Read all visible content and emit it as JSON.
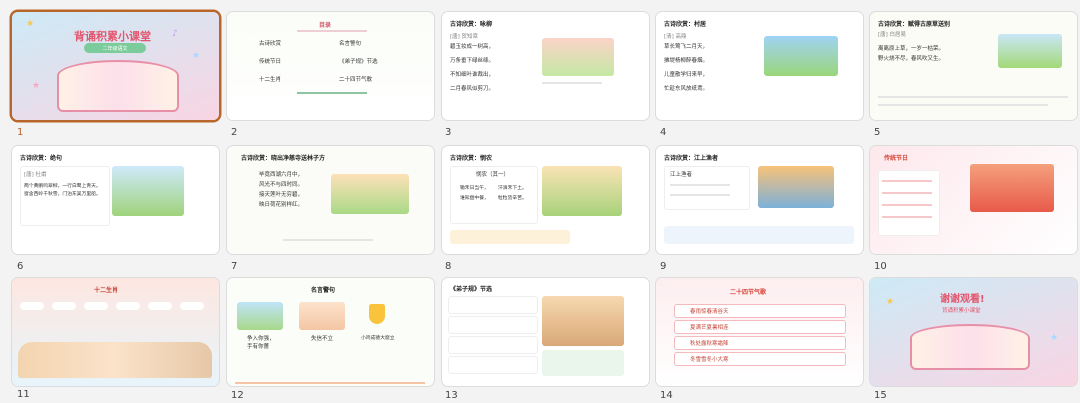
{
  "slides": [
    {
      "num": "1",
      "title": "背诵积累小课堂",
      "subtitle": "二年级语文"
    },
    {
      "num": "2",
      "title": "目录",
      "items": [
        "古诗欣赏",
        "名言警句",
        "传统节日",
        "《弟子规》节选",
        "十二生肖",
        "二十四节气歌"
      ]
    },
    {
      "num": "3",
      "title": "古诗欣赏：咏柳",
      "author": "[唐] 贺知章",
      "lines": [
        "碧玉妆成一树高，",
        "万条垂下绿丝绦。",
        "不知细叶谁裁出，",
        "二月春风似剪刀。"
      ]
    },
    {
      "num": "4",
      "title": "古诗欣赏：村居",
      "author": "[清] 高鼎",
      "lines": [
        "草长莺飞二月天，",
        "拂堤杨柳醉春烟。",
        "儿童散学归来早，",
        "忙趁东风放纸鸢。"
      ]
    },
    {
      "num": "5",
      "title": "古诗欣赏：赋得古原草送别",
      "author": "[唐] 白居易",
      "lines": [
        "离离原上草，一岁一枯荣。",
        "野火烧不尽，春风吹又生。"
      ]
    },
    {
      "num": "6",
      "title": "古诗欣赏：绝句",
      "author": "[唐] 杜甫",
      "lines": [
        "两个黄鹂鸣翠柳，一行白鹭上青天。",
        "窗含西岭千秋雪，门泊东吴万里船。"
      ]
    },
    {
      "num": "7",
      "title": "古诗欣赏：晓出净慈寺送林子方",
      "lines": [
        "毕竟西湖六月中，",
        "风光不与四时同。",
        "接天莲叶无穷碧，",
        "映日荷花别样红。"
      ]
    },
    {
      "num": "8",
      "title": "古诗欣赏：悯农",
      "poem_title": "悯农（其一）",
      "lines": [
        "锄禾日当午，",
        "汗滴禾下土。",
        "谁知盘中餐，",
        "粒粒皆辛苦。"
      ]
    },
    {
      "num": "9",
      "title": "古诗欣赏：江上渔者",
      "poem_title": "江上渔者"
    },
    {
      "num": "10",
      "title": "传统节日"
    },
    {
      "num": "11",
      "title": "十二生肖"
    },
    {
      "num": "12",
      "title": "名言警句",
      "items": [
        "争入你强，",
        "手有你蔷",
        "失信不立",
        "小鸡成德大窟立"
      ]
    },
    {
      "num": "13",
      "title": "《弟子规》节选"
    },
    {
      "num": "14",
      "title": "二十四节气歌",
      "items": [
        "春雨惊春清谷天",
        "夏满芒夏暑相连",
        "秋处露秋寒霜降",
        "冬雪雪冬小大寒"
      ]
    },
    {
      "num": "15",
      "title": "谢谢观看!",
      "subtitle": "背诵积累小课堂"
    }
  ],
  "colors": {
    "accent": "#b8662a",
    "pink": "#f08aa0",
    "red": "#d9463b"
  }
}
